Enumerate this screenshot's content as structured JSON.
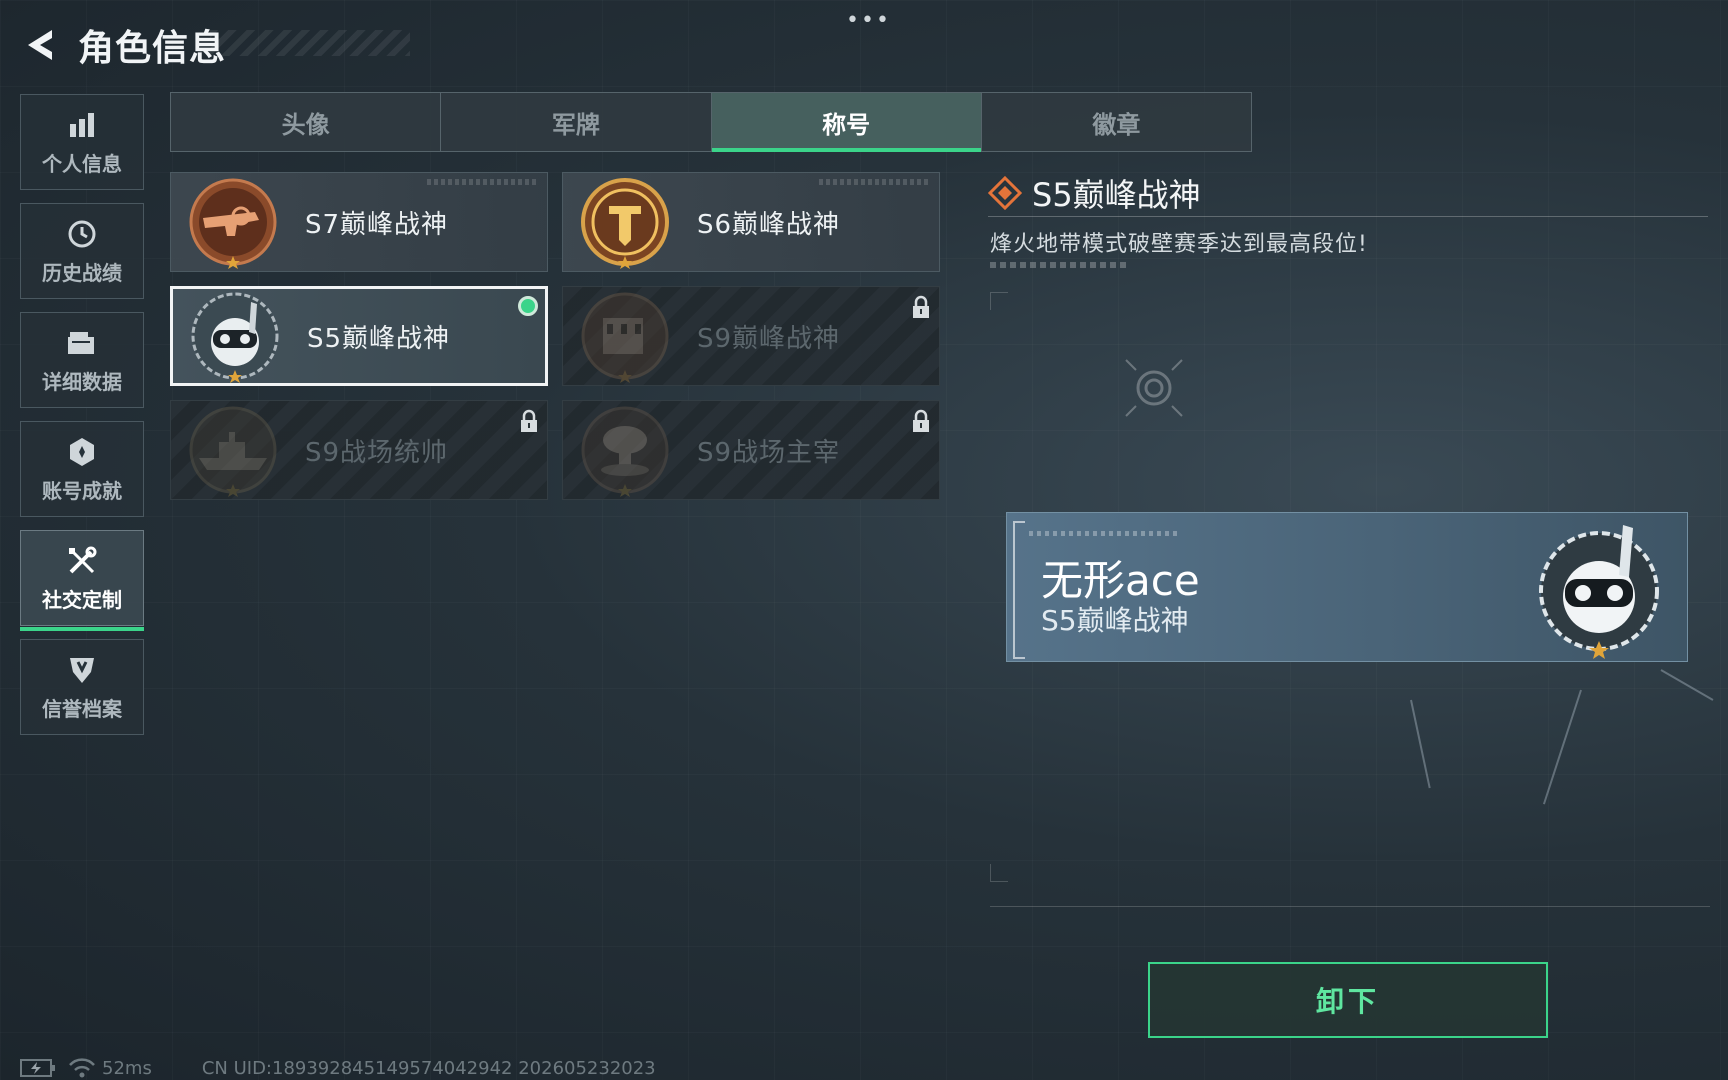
{
  "header": {
    "title": "角色信息"
  },
  "nav": {
    "items": [
      {
        "label": "个人信息",
        "icon": "bar-chart-icon"
      },
      {
        "label": "历史战绩",
        "icon": "clock-icon"
      },
      {
        "label": "详细数据",
        "icon": "folder-icon"
      },
      {
        "label": "账号成就",
        "icon": "medal-icon"
      },
      {
        "label": "社交定制",
        "icon": "tools-icon",
        "active": true
      },
      {
        "label": "信誉档案",
        "icon": "shield-icon"
      }
    ]
  },
  "tabs": [
    {
      "label": "头像"
    },
    {
      "label": "军牌"
    },
    {
      "label": "称号",
      "active": true
    },
    {
      "label": "徽章"
    }
  ],
  "titles": [
    {
      "name": "S7巅峰战神",
      "locked": false,
      "emblem": "gun-emblem-icon"
    },
    {
      "name": "S6巅峰战神",
      "locked": false,
      "emblem": "shield-emblem-icon"
    },
    {
      "name": "S5巅峰战神",
      "locked": false,
      "selected": true,
      "equipped": true,
      "emblem": "diver-skull-emblem-icon"
    },
    {
      "name": "S9巅峰战神",
      "locked": true,
      "emblem": "building-emblem-icon"
    },
    {
      "name": "S9战场统帅",
      "locked": true,
      "emblem": "warship-emblem-icon"
    },
    {
      "name": "S9战场主宰",
      "locked": true,
      "emblem": "mushroom-cloud-emblem-icon"
    }
  ],
  "detail": {
    "name": "S5巅峰战神",
    "description": "烽火地带模式破壁赛季达到最高段位!"
  },
  "preview": {
    "player_name": "无形ace",
    "title": "S5巅峰战神"
  },
  "actions": {
    "unequip_label": "卸下"
  },
  "footer": {
    "ping": "52ms",
    "uid": "CN UID:1893928451495740429​42 202605232023"
  },
  "colors": {
    "accent_green": "#3bd48a",
    "emblem_bronze": "#a0623a",
    "detail_icon_orange": "#e4743a"
  }
}
